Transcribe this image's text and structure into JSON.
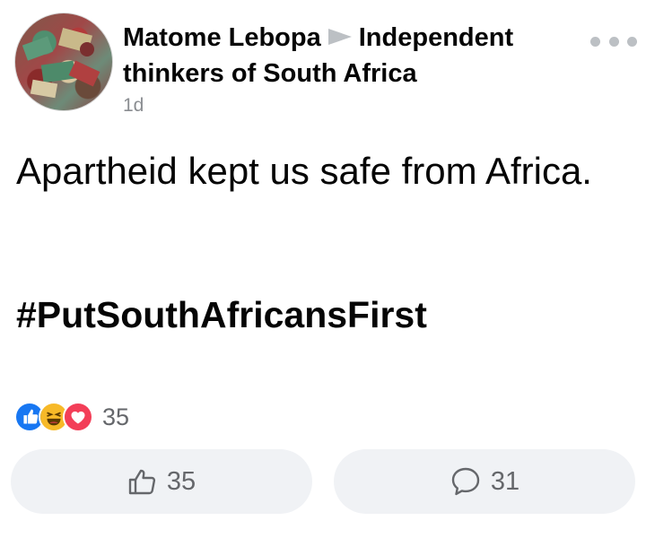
{
  "post": {
    "author": "Matome Lebopa",
    "group": "Independent thinkers of South Africa",
    "timestamp": "1d",
    "message": "Apartheid kept us safe from Africa.",
    "hashtag": "#PutSouthAfricansFirst"
  },
  "reactions": {
    "types": [
      "like-icon",
      "haha-icon",
      "love-icon"
    ],
    "count": "35"
  },
  "actions": {
    "like_count": "35",
    "comment_count": "31"
  },
  "colors": {
    "like_blue": "#1877f2",
    "haha_yellow": "#f7b928",
    "love_red": "#f33e58",
    "button_bg": "#f0f2f5",
    "secondary_text": "#65676b"
  }
}
